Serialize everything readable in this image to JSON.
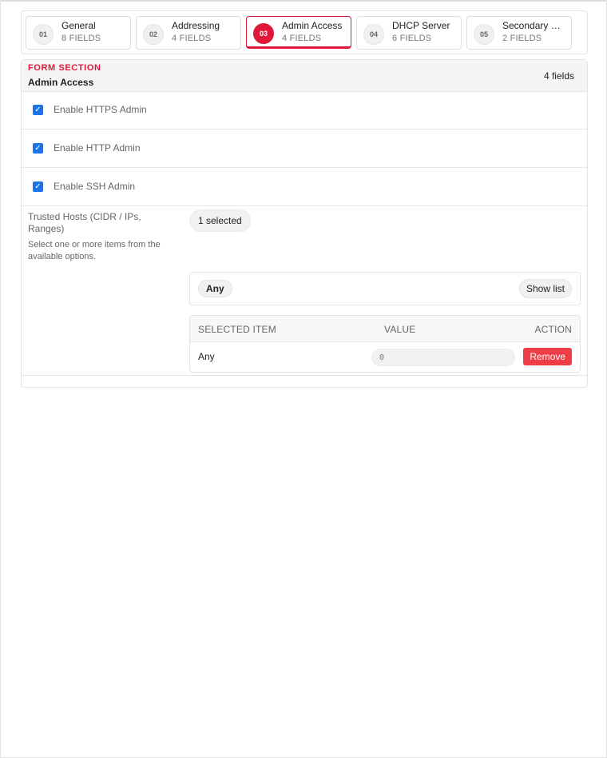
{
  "steps": [
    {
      "num": "01",
      "title": "General",
      "sub": "8 FIELDS"
    },
    {
      "num": "02",
      "title": "Addressing",
      "sub": "4 FIELDS"
    },
    {
      "num": "03",
      "title": "Admin Access",
      "sub": "4 FIELDS"
    },
    {
      "num": "04",
      "title": "DHCP Server",
      "sub": "6 FIELDS"
    },
    {
      "num": "05",
      "title": "Secondary …",
      "sub": "2 FIELDS"
    }
  ],
  "section": {
    "kicker": "FORM SECTION",
    "title": "Admin Access",
    "count": "4 fields"
  },
  "checks": [
    {
      "label": "Enable HTTPS Admin",
      "checked": true
    },
    {
      "label": "Enable HTTP Admin",
      "checked": true
    },
    {
      "label": "Enable SSH Admin",
      "checked": true
    }
  ],
  "trusted_hosts": {
    "label": "Trusted Hosts (CIDR / IPs, Ranges)",
    "help": "Select one or more items from the available options.",
    "selected_count": "1 selected",
    "chip": "Any",
    "show_list": "Show list",
    "table": {
      "headers": {
        "item": "SELECTED ITEM",
        "value": "VALUE",
        "action": "ACTION"
      },
      "rows": [
        {
          "item": "Any",
          "value_placeholder": "0",
          "action": "Remove"
        }
      ]
    }
  },
  "colors": {
    "accent": "#e0193a",
    "checkbox": "#1a73e8",
    "danger": "#ee3d47"
  }
}
